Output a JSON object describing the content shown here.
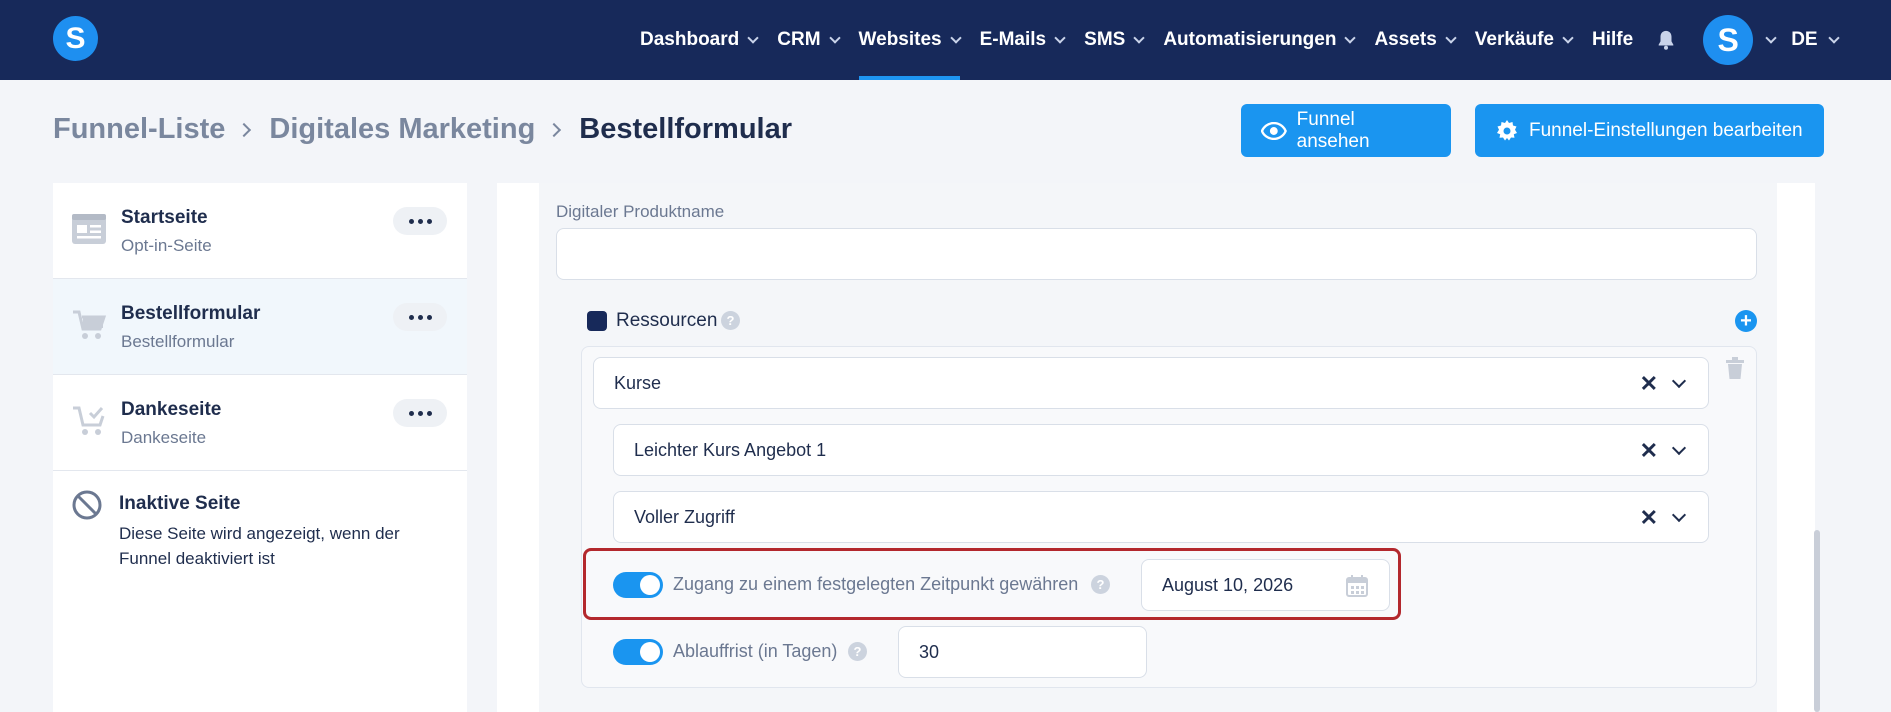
{
  "nav": {
    "logo": "S",
    "items": [
      {
        "label": "Dashboard",
        "has_chevron": true
      },
      {
        "label": "CRM",
        "has_chevron": true
      },
      {
        "label": "Websites",
        "has_chevron": true,
        "active": true
      },
      {
        "label": "E-Mails",
        "has_chevron": true
      },
      {
        "label": "SMS",
        "has_chevron": true
      },
      {
        "label": "Automatisierungen",
        "has_chevron": true
      },
      {
        "label": "Assets",
        "has_chevron": true
      },
      {
        "label": "Verkäufe",
        "has_chevron": true
      },
      {
        "label": "Hilfe",
        "has_chevron": false
      }
    ],
    "avatar": "S",
    "language": "DE",
    "colors": {
      "bar": "#17295a",
      "active_underline": "#1e95f2"
    }
  },
  "breadcrumb": {
    "items": [
      "Funnel-Liste",
      "Digitales Marketing"
    ],
    "current": "Bestellformular"
  },
  "actions": {
    "view_funnel": "Funnel ansehen",
    "edit_settings": "Funnel-Einstellungen bearbeiten"
  },
  "sidebar": {
    "steps": [
      {
        "title": "Startseite",
        "subtitle": "Opt-in-Seite",
        "icon": "landing-page-icon"
      },
      {
        "title": "Bestellformular",
        "subtitle": "Bestellformular",
        "icon": "cart-icon",
        "active": true
      },
      {
        "title": "Dankeseite",
        "subtitle": "Dankeseite",
        "icon": "cart-check-icon"
      }
    ],
    "inactive": {
      "title": "Inaktive Seite",
      "text": "Diese Seite wird angezeigt, wenn der Funnel deaktiviert ist"
    }
  },
  "form": {
    "product_name_label": "Digitaler Produktname",
    "product_name_value": "",
    "resources_label": "Ressourcen",
    "help_glyph": "?",
    "resource_type": "Kurse",
    "course": "Leichter Kurs Angebot 1",
    "access_level": "Voller Zugriff",
    "clear_glyph": "✕",
    "grant_access_label": "Zugang zu einem festgelegten Zeitpunkt gewähren",
    "grant_access_enabled": true,
    "grant_access_date": "August 10, 2026",
    "expiry_label": "Ablauffrist (in Tagen)",
    "expiry_enabled": true,
    "expiry_days": "30"
  }
}
